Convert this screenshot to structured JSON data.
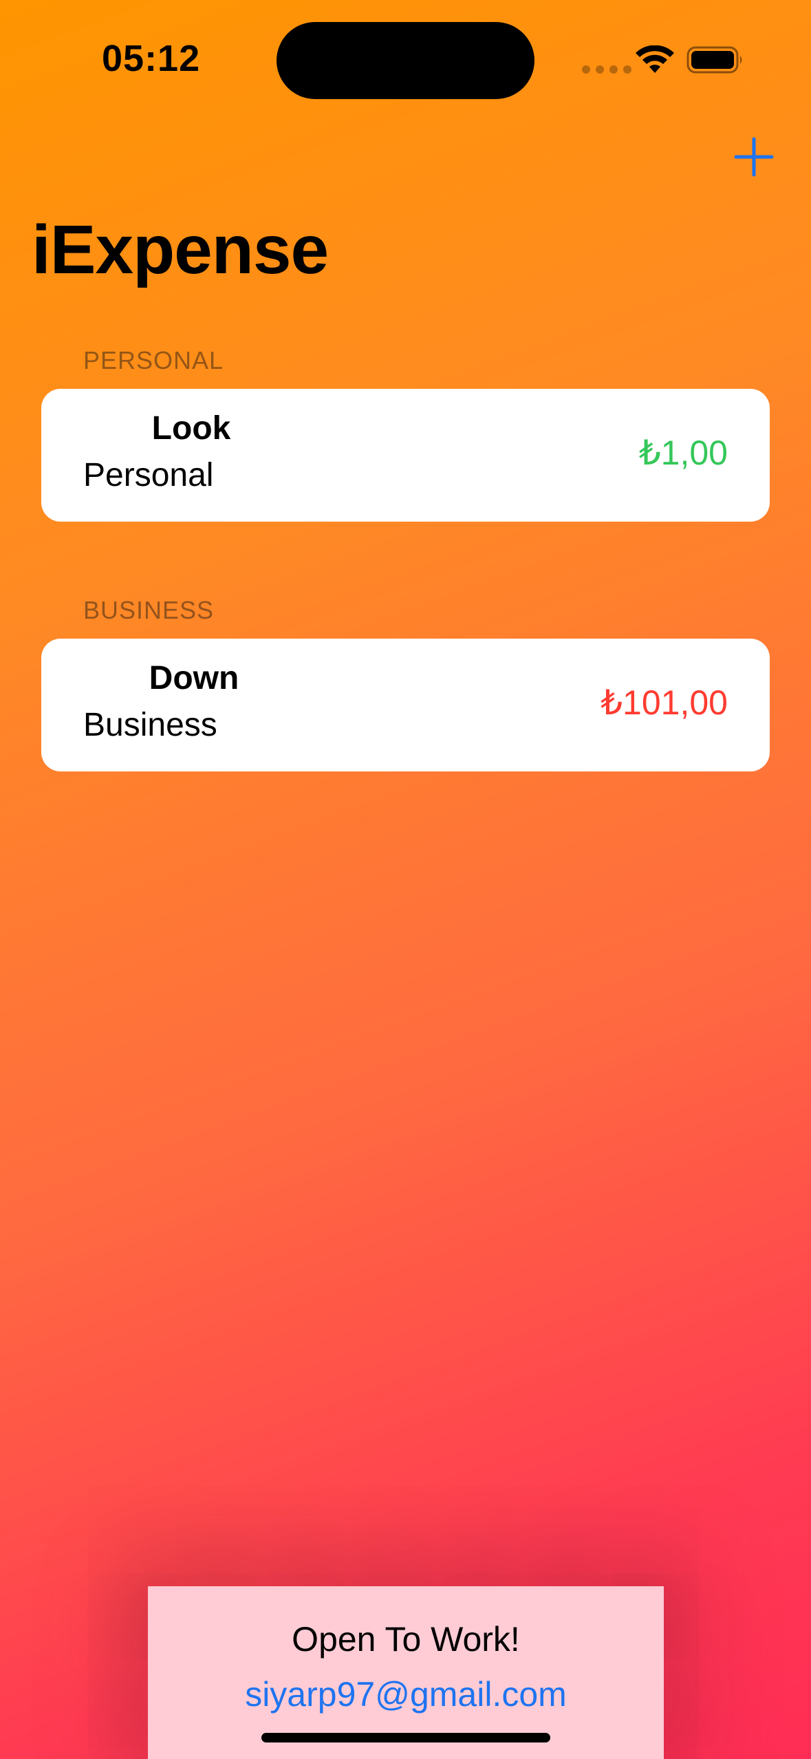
{
  "status_bar": {
    "time": "05:12"
  },
  "nav": {
    "add_icon": "plus-icon",
    "accent_color": "#1E74F0"
  },
  "title": "iExpense",
  "sections": [
    {
      "header": "PERSONAL",
      "items": [
        {
          "name": "Look",
          "type": "Personal",
          "amount": "₺1,00",
          "amount_color": "#34C759"
        }
      ]
    },
    {
      "header": "BUSINESS",
      "items": [
        {
          "name": "Down",
          "type": "Business",
          "amount": "₺101,00",
          "amount_color": "#FF3B30"
        }
      ]
    }
  ],
  "footer": {
    "title": "Open To Work!",
    "email": "siyarp97@gmail.com"
  },
  "colors": {
    "background_top": "#FF9500",
    "background_bottom": "#FF2D55",
    "footer_background": "#FFCCD5"
  }
}
